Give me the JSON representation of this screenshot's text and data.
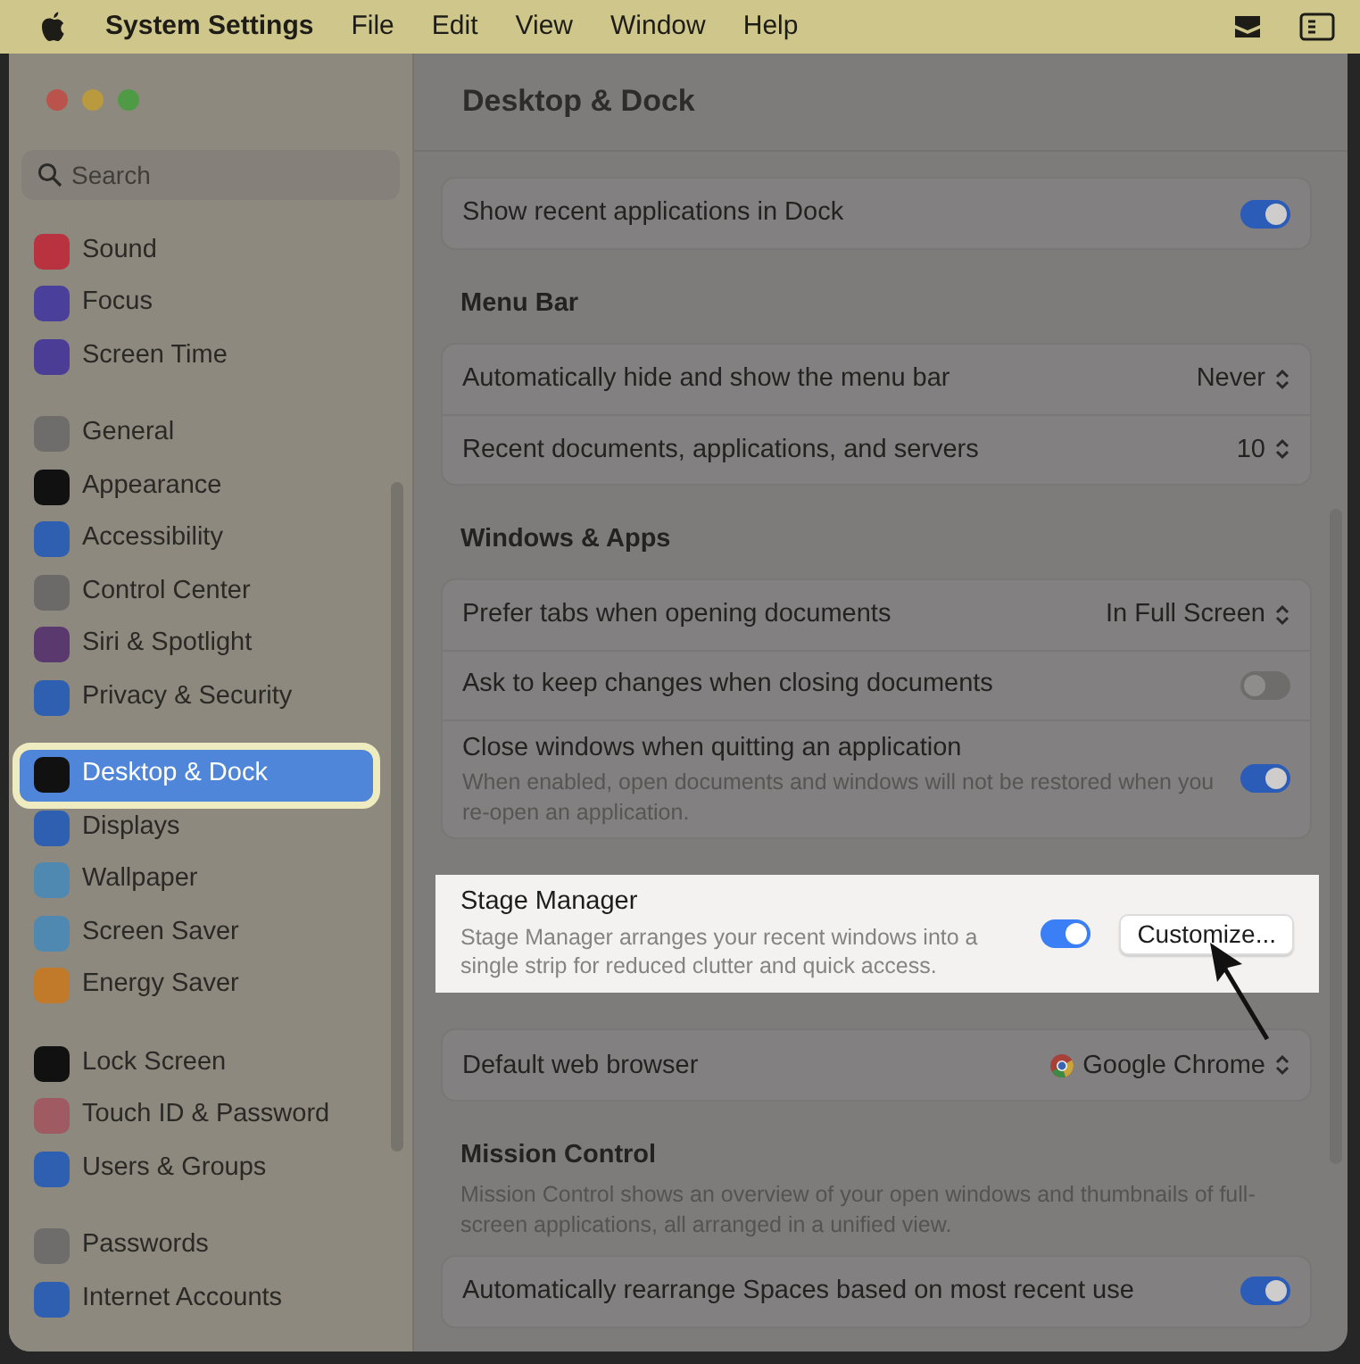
{
  "menu_bar": {
    "app": "System Settings",
    "menus": [
      "File",
      "Edit",
      "View",
      "Window",
      "Help"
    ]
  },
  "window": {
    "title": "Desktop & Dock"
  },
  "sidebar": {
    "search": {
      "placeholder": "Search"
    },
    "groups": [
      {
        "items": [
          {
            "label": "Sound",
            "color": "#b8323f",
            "selected": false,
            "highlighted": false
          },
          {
            "label": "Focus",
            "color": "#4a3f9a",
            "selected": false,
            "highlighted": false
          },
          {
            "label": "Screen Time",
            "color": "#4b3c95",
            "selected": false,
            "highlighted": false
          }
        ]
      },
      {
        "items": [
          {
            "label": "General",
            "color": "#6f6d6b",
            "selected": false,
            "highlighted": false
          },
          {
            "label": "Appearance",
            "color": "#111111",
            "selected": false,
            "highlighted": false
          },
          {
            "label": "Accessibility",
            "color": "#2f5fb0",
            "selected": false,
            "highlighted": false
          },
          {
            "label": "Control Center",
            "color": "#6b6a69",
            "selected": false,
            "highlighted": false
          },
          {
            "label": "Siri & Spotlight",
            "color": "#5a3a6e",
            "selected": false,
            "highlighted": false
          },
          {
            "label": "Privacy & Security",
            "color": "#2f5fb0",
            "selected": false,
            "highlighted": false
          }
        ]
      },
      {
        "items": [
          {
            "label": "Desktop & Dock",
            "color": "#111111",
            "selected": true,
            "highlighted": true
          },
          {
            "label": "Displays",
            "color": "#2f5fb0",
            "selected": false,
            "highlighted": false
          },
          {
            "label": "Wallpaper",
            "color": "#4f88b0",
            "selected": false,
            "highlighted": false
          },
          {
            "label": "Screen Saver",
            "color": "#4f88b0",
            "selected": false,
            "highlighted": false
          },
          {
            "label": "Energy Saver",
            "color": "#c07a2a",
            "selected": false,
            "highlighted": false
          }
        ]
      },
      {
        "items": [
          {
            "label": "Lock Screen",
            "color": "#111111",
            "selected": false,
            "highlighted": false
          },
          {
            "label": "Touch ID & Password",
            "color": "#a05a62",
            "selected": false,
            "highlighted": false
          },
          {
            "label": "Users & Groups",
            "color": "#2f5fb0",
            "selected": false,
            "highlighted": false
          }
        ]
      },
      {
        "items": [
          {
            "label": "Passwords",
            "color": "#6f6d6b",
            "selected": false,
            "highlighted": false
          },
          {
            "label": "Internet Accounts",
            "color": "#2f5fb0",
            "selected": false,
            "highlighted": false
          }
        ]
      }
    ]
  },
  "sections": [
    {
      "rows": [
        {
          "kind": "toggle",
          "label": "Show recent applications in Dock",
          "on": true
        }
      ]
    },
    {
      "title": "Menu Bar",
      "rows": [
        {
          "kind": "popup",
          "label": "Automatically hide and show the menu bar",
          "value": "Never"
        },
        {
          "kind": "popup",
          "label": "Recent documents, applications, and servers",
          "value": "10"
        }
      ]
    },
    {
      "title": "Windows & Apps",
      "rows": [
        {
          "kind": "popup",
          "label": "Prefer tabs when opening documents",
          "value": "In Full Screen"
        },
        {
          "kind": "toggle",
          "label": "Ask to keep changes when closing documents",
          "on": false
        },
        {
          "kind": "toggle",
          "label": "Close windows when quitting an application",
          "on": true,
          "description": "When enabled, open documents and windows will not be restored when you re-open an application."
        }
      ]
    },
    {
      "highlighted": true,
      "rows": [
        {
          "kind": "toggle_button",
          "label": "Stage Manager",
          "on": true,
          "button": "Customize...",
          "description": "Stage Manager arranges your recent windows into a single strip for reduced clutter and quick access."
        }
      ]
    },
    {
      "rows": [
        {
          "kind": "browser_popup",
          "label": "Default web browser",
          "value": "Google Chrome"
        }
      ]
    },
    {
      "title": "Mission Control",
      "description": "Mission Control shows an overview of your open windows and thumbnails of full-screen applications, all arranged in a unified view.",
      "rows": [
        {
          "kind": "toggle",
          "label": "Automatically rearrange Spaces based on most recent use",
          "on": true
        }
      ]
    }
  ]
}
